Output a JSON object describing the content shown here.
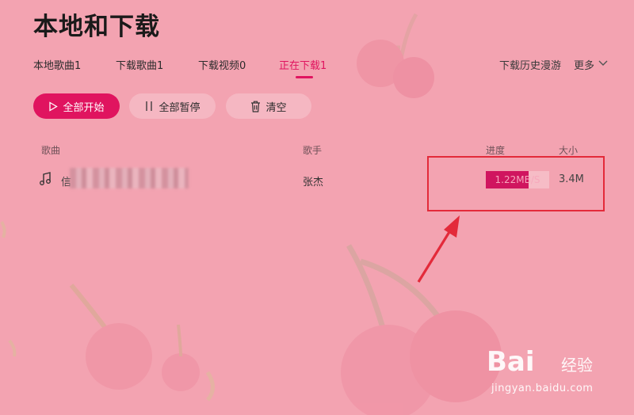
{
  "header": {
    "title": "本地和下载"
  },
  "tabs": [
    {
      "label": "本地歌曲1",
      "active": false
    },
    {
      "label": "下载歌曲1",
      "active": false
    },
    {
      "label": "下载视频0",
      "active": false
    },
    {
      "label": "正在下载1",
      "active": true
    }
  ],
  "top_right": {
    "history_label": "下载历史漫游",
    "more_label": "更多"
  },
  "toolbar": {
    "start_all_label": "全部开始",
    "pause_all_label": "全部暂停",
    "clear_label": "清空"
  },
  "table": {
    "columns": {
      "song": "歌曲",
      "singer": "歌手",
      "progress": "进度",
      "size": "大小"
    },
    "rows": [
      {
        "song": "信",
        "singer": "张杰",
        "progress_text": "1.22MB/S",
        "progress_fraction": 0.67,
        "size": "3.4M"
      }
    ]
  },
  "watermark": {
    "brand": "Bai",
    "suffix": "经验",
    "url": "jingyan.baidu.com"
  },
  "colors": {
    "accent": "#e0145f",
    "background": "#f3a3b1",
    "annotation": "#e32a3a"
  },
  "icons": {
    "play": "play-icon",
    "pause": "pause-icon",
    "trash": "trash-icon",
    "music": "music-note-icon",
    "chevron": "chevron-down-icon"
  }
}
